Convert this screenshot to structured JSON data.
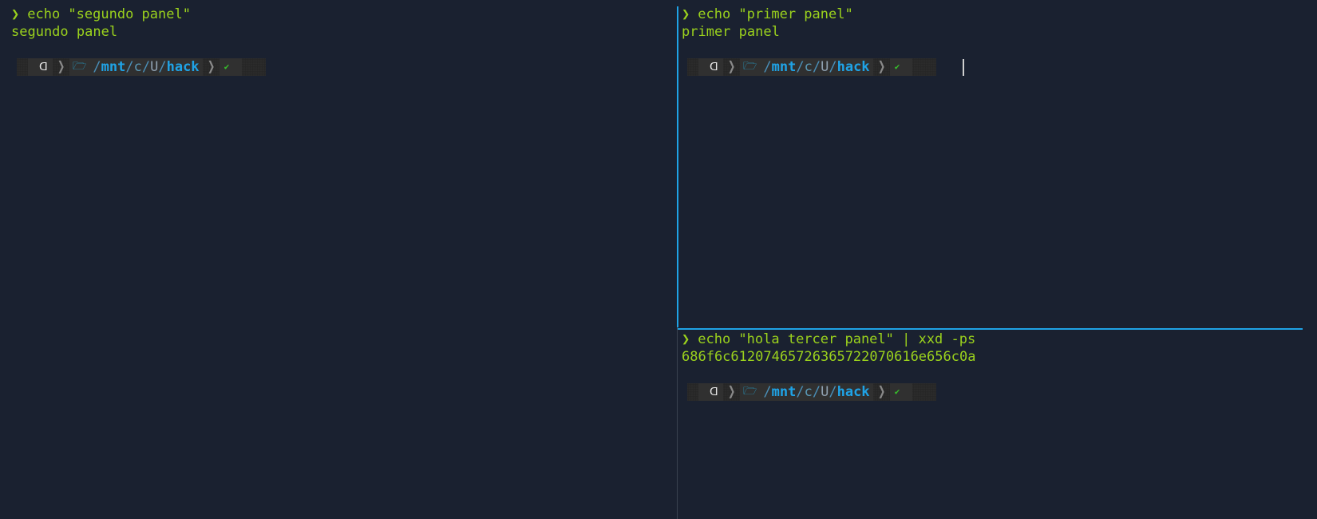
{
  "prompt_char": "❯",
  "panes": {
    "left": {
      "command": "echo \"segundo panel\"",
      "output": "segundo panel"
    },
    "top_right": {
      "command": "echo \"primer panel\"",
      "output": "primer panel"
    },
    "bottom_right": {
      "command": "echo \"hola tercer panel\" | xxd -ps",
      "output": "686f6c61207465726365722070616e656c0a"
    }
  },
  "powerline": {
    "os_icon": "ᗡ",
    "separator": "❯",
    "folder_icon": "🗁",
    "path": {
      "slash1": "/",
      "seg1": "mnt",
      "slash2": "/",
      "seg2": "c",
      "slash3": "/",
      "seg3": "U",
      "slash4": "/",
      "seg4": "hack"
    },
    "status_icon": "✔"
  },
  "colors": {
    "background": "#1a2130",
    "text": "#9bd21d",
    "active_border": "#1fa3e6",
    "path_bold": "#1fa3e6",
    "status_ok": "#37c12b"
  }
}
